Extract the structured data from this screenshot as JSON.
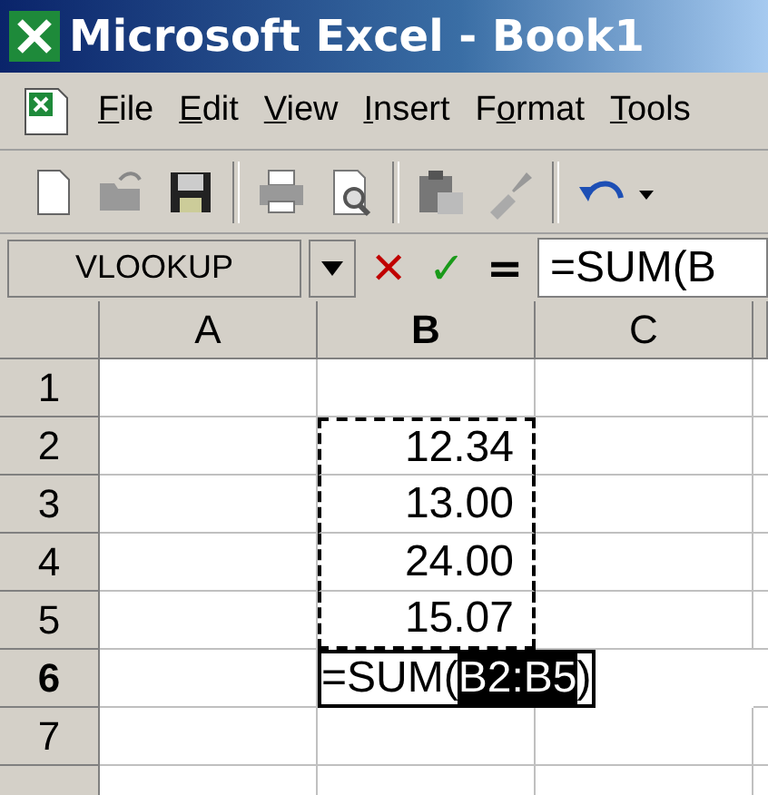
{
  "window": {
    "title": "Microsoft Excel - Book1"
  },
  "menu": [
    {
      "key": "F",
      "after": "ile"
    },
    {
      "key": "E",
      "after": "dit"
    },
    {
      "key": "V",
      "after": "iew"
    },
    {
      "key": "I",
      "after": "nsert"
    },
    {
      "before": "F",
      "key": "o",
      "after": "rmat"
    },
    {
      "key": "T",
      "after": "ools"
    }
  ],
  "toolbar": [
    {
      "kind": "new"
    },
    {
      "kind": "open"
    },
    {
      "kind": "save"
    },
    {
      "kind": "sep"
    },
    {
      "kind": "print"
    },
    {
      "kind": "preview"
    },
    {
      "kind": "sep"
    },
    {
      "kind": "paste"
    },
    {
      "kind": "brush"
    },
    {
      "kind": "sep"
    },
    {
      "kind": "undo"
    }
  ],
  "formula_bar": {
    "name_box": "VLOOKUP",
    "cancel": "✕",
    "enter": "✓",
    "equals": "=",
    "formula": "=SUM(B"
  },
  "columns": [
    {
      "label": "A",
      "selected": false
    },
    {
      "label": "B",
      "selected": true
    },
    {
      "label": "C",
      "selected": false
    }
  ],
  "rows": [
    {
      "label": "1",
      "selected": false,
      "cells": [
        {},
        {},
        {}
      ]
    },
    {
      "label": "2",
      "selected": false,
      "cells": [
        {},
        {
          "value": "12.34",
          "marquee": true
        },
        {}
      ]
    },
    {
      "label": "3",
      "selected": false,
      "cells": [
        {},
        {
          "value": "13.00",
          "marquee": true
        },
        {}
      ]
    },
    {
      "label": "4",
      "selected": false,
      "cells": [
        {},
        {
          "value": "24.00",
          "marquee": true
        },
        {}
      ]
    },
    {
      "label": "5",
      "selected": false,
      "cells": [
        {},
        {
          "value": "15.07",
          "marquee": true
        },
        {}
      ]
    },
    {
      "label": "6",
      "selected": true,
      "cells": [
        {},
        {
          "editing": [
            {
              "text": "=SUM(",
              "selected": false
            },
            {
              "text": "B2:B5",
              "selected": true
            },
            {
              "text": ")",
              "selected": false
            }
          ]
        }
      ]
    },
    {
      "label": "7",
      "selected": false,
      "cells": [
        {},
        {},
        {}
      ]
    },
    {
      "cells": [
        {},
        {},
        {}
      ]
    }
  ]
}
